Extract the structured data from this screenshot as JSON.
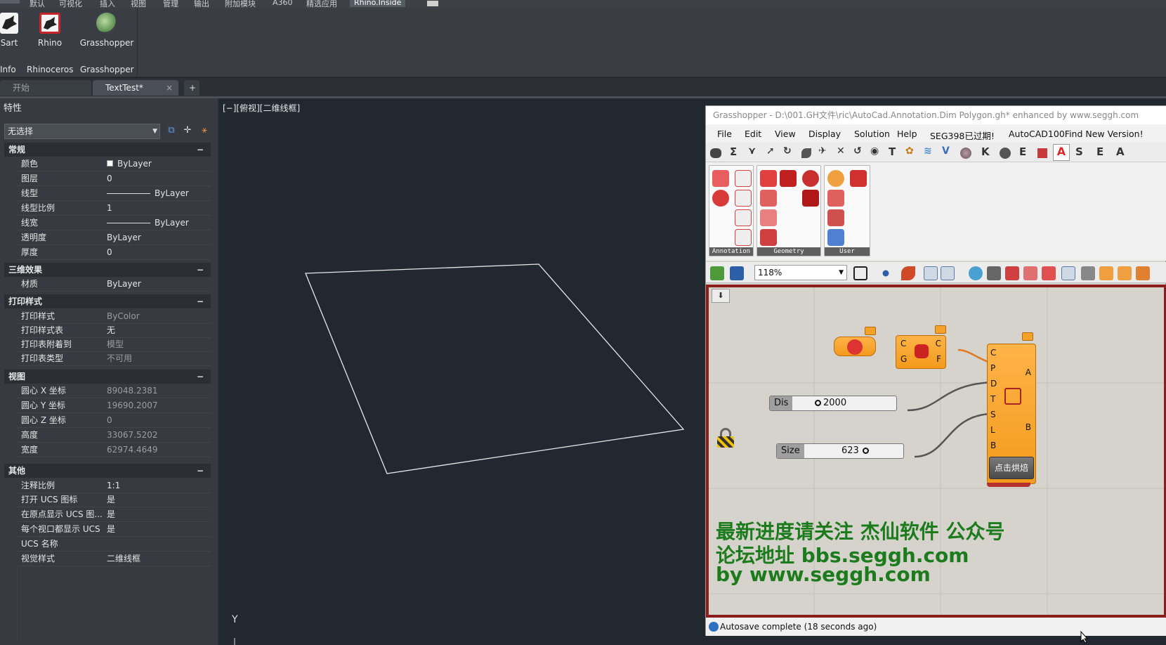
{
  "menubar": {
    "items": [
      "默认",
      "可视化",
      "插入",
      "视图",
      "管理",
      "输出",
      "附加模块",
      "A360",
      "精选应用"
    ],
    "active": "Rhino.Inside"
  },
  "ribbon": {
    "buttons": [
      {
        "label": "Sart",
        "icon": "rhino-inside-icon"
      },
      {
        "label": "Rhino",
        "icon": "rhino-icon"
      },
      {
        "label": "Grasshopper",
        "icon": "grasshopper-icon"
      }
    ],
    "groups": [
      "Info",
      "Rhinoceros",
      "Grasshopper"
    ]
  },
  "doc_tabs": {
    "tabs": [
      "开始",
      "TextTest*"
    ],
    "active_index": 1,
    "close_symbol": "×",
    "add_symbol": "+"
  },
  "properties": {
    "title": "特性",
    "selection": "无选择",
    "sections": [
      {
        "name": "常规",
        "rows": [
          {
            "key": "颜色",
            "value": "ByLayer"
          },
          {
            "key": "图层",
            "value": "0"
          },
          {
            "key": "线型",
            "value": "ByLayer"
          },
          {
            "key": "线型比例",
            "value": "1"
          },
          {
            "key": "线宽",
            "value": "ByLayer"
          },
          {
            "key": "透明度",
            "value": "ByLayer"
          },
          {
            "key": "厚度",
            "value": "0"
          }
        ]
      },
      {
        "name": "三维效果",
        "rows": [
          {
            "key": "材质",
            "value": "ByLayer"
          }
        ]
      },
      {
        "name": "打印样式",
        "rows": [
          {
            "key": "打印样式",
            "value": "ByColor"
          },
          {
            "key": "打印样式表",
            "value": "无"
          },
          {
            "key": "打印表附着到",
            "value": "模型"
          },
          {
            "key": "打印表类型",
            "value": "不可用"
          }
        ]
      },
      {
        "name": "视图",
        "rows": [
          {
            "key": "圆心 X 坐标",
            "value": "89048.2381"
          },
          {
            "key": "圆心 Y 坐标",
            "value": "19690.2007"
          },
          {
            "key": "圆心 Z 坐标",
            "value": "0"
          },
          {
            "key": "高度",
            "value": "33067.5202"
          },
          {
            "key": "宽度",
            "value": "62974.4649"
          }
        ]
      },
      {
        "name": "其他",
        "rows": [
          {
            "key": "注释比例",
            "value": "1:1"
          },
          {
            "key": "打开 UCS 图标",
            "value": "是"
          },
          {
            "key": "在原点显示 UCS 图...",
            "value": "是"
          },
          {
            "key": "每个视口都显示 UCS",
            "value": "是"
          },
          {
            "key": "UCS 名称",
            "value": ""
          },
          {
            "key": "视觉样式",
            "value": "二维线框"
          }
        ]
      }
    ],
    "collapse_symbol": "−"
  },
  "viewport": {
    "label": "[−][俯视][二维线框]",
    "axis_label": "Y"
  },
  "grasshopper": {
    "title": "Grasshopper - D:\\001.GH文件\\ric\\AutoCad.Annotation.Dim Polygon.gh*  enhanced by www.seggh.com",
    "menu": [
      "File",
      "Edit",
      "View",
      "Display",
      "Solution",
      "Help",
      "SEG398已过期!",
      "AutoCAD100Find New Version!"
    ],
    "tab_letters": [
      "T",
      "K",
      "E",
      "S",
      "E",
      "A"
    ],
    "panels": [
      "Annotation",
      "Geometry",
      "User"
    ],
    "zoom": "118%",
    "sliders": [
      {
        "label": "Dis",
        "value": "2000"
      },
      {
        "label": "Size",
        "value": "623"
      }
    ],
    "inputs_left": [
      "C",
      "G"
    ],
    "outputs_right": [
      "C",
      "F"
    ],
    "main_inputs": [
      "C",
      "P",
      "D",
      "T",
      "S",
      "L",
      "B"
    ],
    "main_outputs": [
      "A",
      "B"
    ],
    "bake_button": "点击烘焙",
    "watermark": [
      "最新进度请关注 杰仙软件 公众号",
      "论坛地址 bbs.seggh.com",
      "by www.seggh.com"
    ],
    "status": "Autosave complete (18 seconds ago)"
  },
  "colors": {
    "autocad_bg": "#212830",
    "gh_canvas": "#d6d3cc",
    "gh_border": "#8b1d1d",
    "component": "#f7a12a",
    "watermark": "#1c7b1c"
  }
}
